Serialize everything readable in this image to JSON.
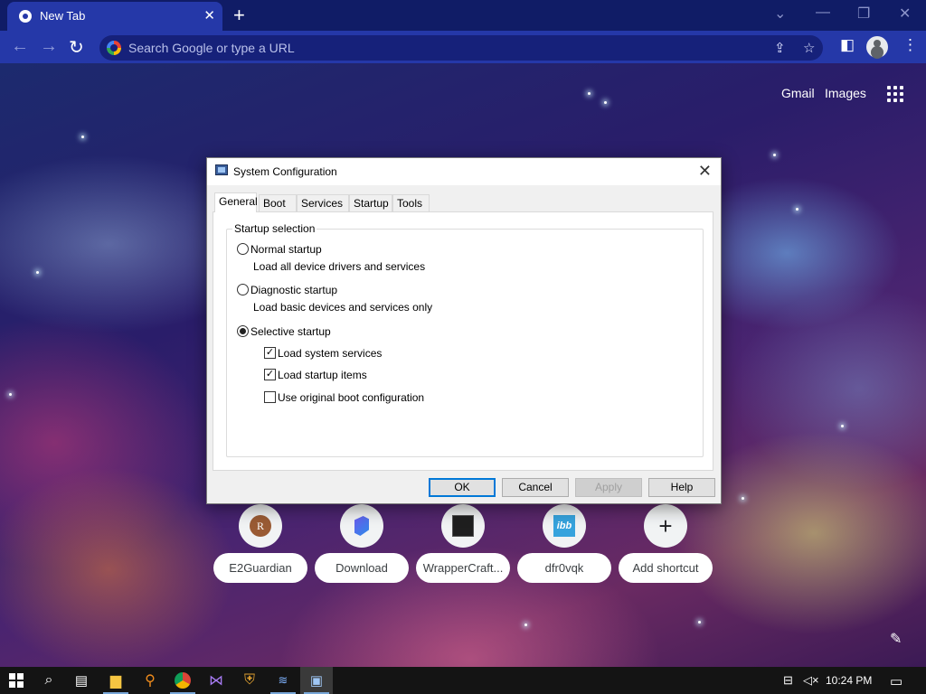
{
  "browser": {
    "tab_title": "New Tab",
    "tab_close": "✕",
    "new_tab": "+",
    "omnibox_placeholder": "Search Google or type a URL",
    "links": {
      "gmail": "Gmail",
      "images": "Images"
    }
  },
  "shortcuts": [
    {
      "label": "E2Guardian",
      "icon_glyph": "R"
    },
    {
      "label": "Download"
    },
    {
      "label": "WrapperCraft..."
    },
    {
      "label": "dfr0vqk",
      "icon_glyph": "ibb"
    },
    {
      "label": "Add shortcut",
      "icon_glyph": "+"
    }
  ],
  "dialog": {
    "title": "System Configuration",
    "tabs": [
      "General",
      "Boot",
      "Services",
      "Startup",
      "Tools"
    ],
    "selected_tab": "General",
    "group_title": "Startup selection",
    "options": {
      "normal": {
        "label": "Normal startup",
        "desc": "Load all device drivers and services",
        "selected": false
      },
      "diagnostic": {
        "label": "Diagnostic startup",
        "desc": "Load basic devices and services only",
        "selected": false
      },
      "selective": {
        "label": "Selective startup",
        "selected": true
      }
    },
    "checks": {
      "system_services": {
        "label": "Load system services",
        "checked": true
      },
      "startup_items": {
        "label": "Load startup items",
        "checked": true
      },
      "original_boot": {
        "label": "Use original boot configuration",
        "checked": false
      }
    },
    "buttons": {
      "ok": "OK",
      "cancel": "Cancel",
      "apply": "Apply",
      "help": "Help"
    }
  },
  "taskbar": {
    "clock": "10:24 PM"
  },
  "colors": {
    "tab_strip": "#101c66",
    "toolbar": "#2538a8",
    "default_button_border": "#0078d7",
    "taskbar": "#141414"
  }
}
